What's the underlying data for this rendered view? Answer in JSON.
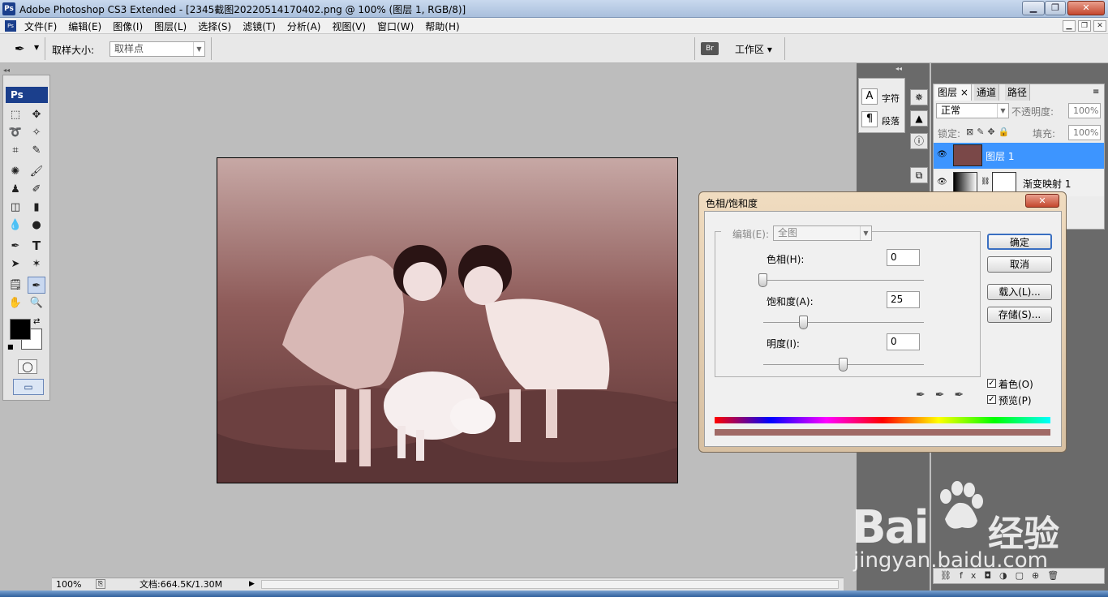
{
  "app": {
    "title": "Adobe Photoshop CS3 Extended - [2345截图20220514170402.png @ 100% (图层 1, RGB/8)]",
    "logo": "Ps"
  },
  "menubar": {
    "items": [
      "文件(F)",
      "编辑(E)",
      "图像(I)",
      "图层(L)",
      "选择(S)",
      "滤镜(T)",
      "分析(A)",
      "视图(V)",
      "窗口(W)",
      "帮助(H)"
    ]
  },
  "options": {
    "sample_size_label": "取样大小:",
    "sample_size_value": "取样点",
    "workspace_label": "工作区 ▾"
  },
  "toolbox": {
    "logo": "Ps"
  },
  "char_panel": {
    "char_label": "字符",
    "para_label": "段落"
  },
  "layers_panel": {
    "tabs": [
      "图层 ×",
      "通道",
      "路径"
    ],
    "blend_mode": "正常",
    "opacity_label": "不透明度:",
    "opacity_value": "100%",
    "lock_label": "锁定:",
    "fill_label": "填充:",
    "fill_value": "100%",
    "layers": [
      {
        "name": "图层 1",
        "selected": true
      },
      {
        "name": "渐变映射 1",
        "selected": false
      }
    ]
  },
  "status": {
    "zoom": "100%",
    "doc_info": "文档:664.5K/1.30M"
  },
  "dialog": {
    "title": "色相/饱和度",
    "edit_label": "编辑(E):",
    "edit_value": "全图",
    "hue_label": "色相(H):",
    "hue_value": "0",
    "saturation_label": "饱和度(A):",
    "saturation_value": "25",
    "lightness_label": "明度(I):",
    "lightness_value": "0",
    "ok_label": "确定",
    "cancel_label": "取消",
    "load_label": "载入(L)...",
    "save_label": "存储(S)...",
    "colorize_label": "着色(O)",
    "colorize_checked": true,
    "preview_label": "预览(P)",
    "preview_checked": true,
    "hue_fraction": 0.0,
    "saturation_fraction": 0.25,
    "lightness_fraction": 0.5
  },
  "watermark": {
    "brand": "Bai",
    "brand2": "经验",
    "url": "jingyan.baidu.com"
  },
  "colors": {
    "selected_layer": "#3d95ff",
    "tint_bar": "#a06a66",
    "canvas_bg": "#bdbdbd"
  }
}
